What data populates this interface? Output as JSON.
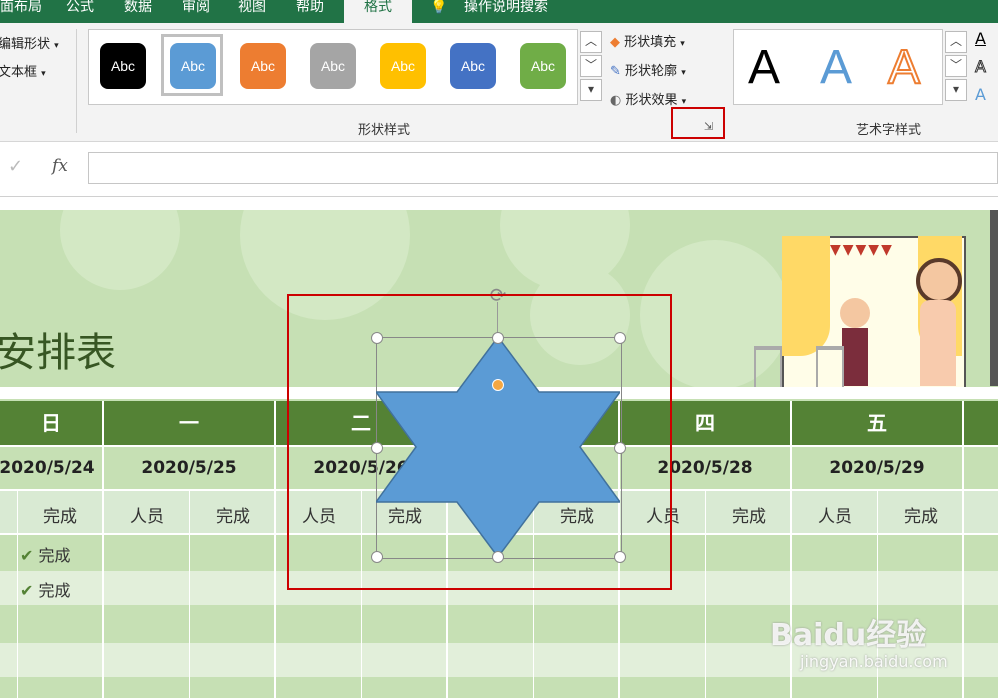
{
  "ribbon": {
    "tabs": [
      "面布局",
      "公式",
      "数据",
      "审阅",
      "视图",
      "帮助",
      "格式",
      "操作说明搜索"
    ],
    "left_commands": [
      "编辑形状",
      "文本框"
    ],
    "shape_styles": [
      {
        "label": "Abc",
        "color": "#000000"
      },
      {
        "label": "Abc",
        "color": "#5b9bd5"
      },
      {
        "label": "Abc",
        "color": "#ed7d31"
      },
      {
        "label": "Abc",
        "color": "#a5a5a5"
      },
      {
        "label": "Abc",
        "color": "#ffc000"
      },
      {
        "label": "Abc",
        "color": "#4472c4"
      },
      {
        "label": "Abc",
        "color": "#70ad47"
      }
    ],
    "shape_fill": "形状填充",
    "shape_outline": "形状轮廓",
    "shape_effects": "形状效果",
    "shape_styles_group": "形状样式",
    "wordart_letters": [
      "A",
      "A",
      "A"
    ],
    "wordart_group": "艺术字样式"
  },
  "formula_bar": {
    "check": "✓",
    "fx": "fx",
    "value": ""
  },
  "sheet": {
    "title_fragment": "安排表",
    "days": [
      "日",
      "一",
      "二",
      "四",
      "五"
    ],
    "dates": [
      "2020/5/24",
      "2020/5/25",
      "2020/5/26",
      "2020/5/28",
      "2020/5/29"
    ],
    "col_person": "人员",
    "col_done": "完成",
    "done_rows": [
      "完成",
      "完成"
    ]
  },
  "watermark": {
    "brand": "Baidu经验",
    "url": "jingyan.baidu.com"
  },
  "colors": {
    "accent_green": "#217346",
    "header_green": "#548235",
    "sheet_green": "#c6e0b4",
    "star_fill": "#5b9bd5",
    "highlight_red": "#cc0000"
  }
}
